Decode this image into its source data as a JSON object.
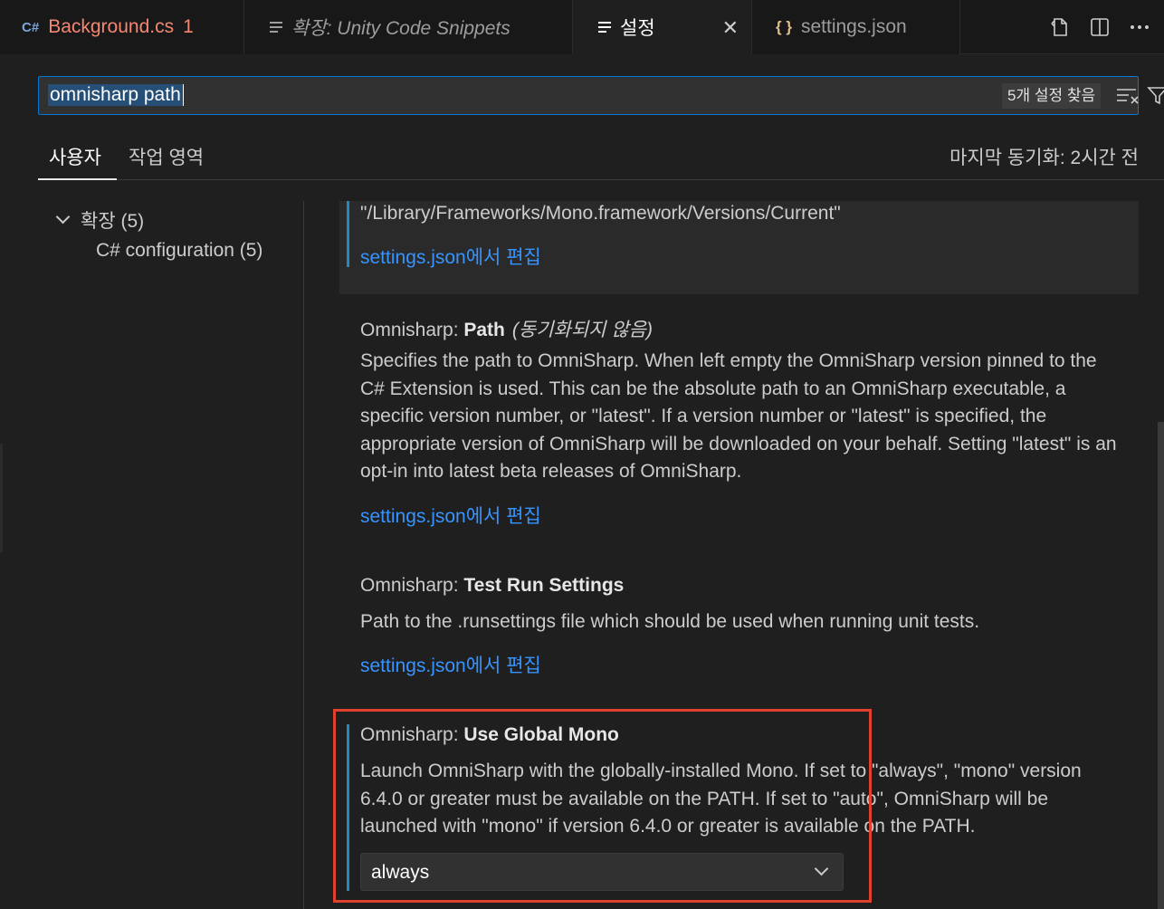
{
  "tabs": [
    {
      "icon": "C#",
      "label": "Background.cs",
      "badge": "1"
    },
    {
      "label": "확장: Unity Code Snippets"
    },
    {
      "label": "설정",
      "close": "✕"
    },
    {
      "icon": "{ }",
      "label": "settings.json"
    }
  ],
  "search": {
    "value": "omnisharp path",
    "result_count": "5개 설정 찾음"
  },
  "scopes": {
    "user": "사용자",
    "workspace": "작업 영역",
    "last_sync": "마지막 동기화: 2시간 전"
  },
  "toc": {
    "group": "확장 (5)",
    "child": "C# configuration (5)"
  },
  "settings": {
    "prev_value": "\"/Library/Frameworks/Mono.framework/Versions/Current\"",
    "edit_link": "settings.json에서 편집",
    "path": {
      "category": "Omnisharp: ",
      "name": "Path",
      "note": "(동기화되지 않음)",
      "description": "Specifies the path to OmniSharp. When left empty the OmniSharp version pinned to the C# Extension is used. This can be the absolute path to an OmniSharp executable, a specific version number, or \"latest\". If a version number or \"latest\" is specified, the appropriate version of OmniSharp will be downloaded on your behalf. Setting \"latest\" is an opt-in into latest beta releases of OmniSharp."
    },
    "test_run": {
      "category": "Omnisharp: ",
      "name": "Test Run Settings",
      "description": "Path to the .runsettings file which should be used when running unit tests."
    },
    "global_mono": {
      "category": "Omnisharp: ",
      "name": "Use Global Mono",
      "description": "Launch OmniSharp with the globally-installed Mono. If set to \"always\", \"mono\" version 6.4.0 or greater must be available on the PATH. If set to \"auto\", OmniSharp will be launched with \"mono\" if version 6.4.0 or greater is available on the PATH.",
      "value": "always"
    }
  },
  "colors": {
    "accent": "#0078d4",
    "link": "#3794ff",
    "highlight_box": "#e0412d",
    "error_tab": "#f48771"
  }
}
